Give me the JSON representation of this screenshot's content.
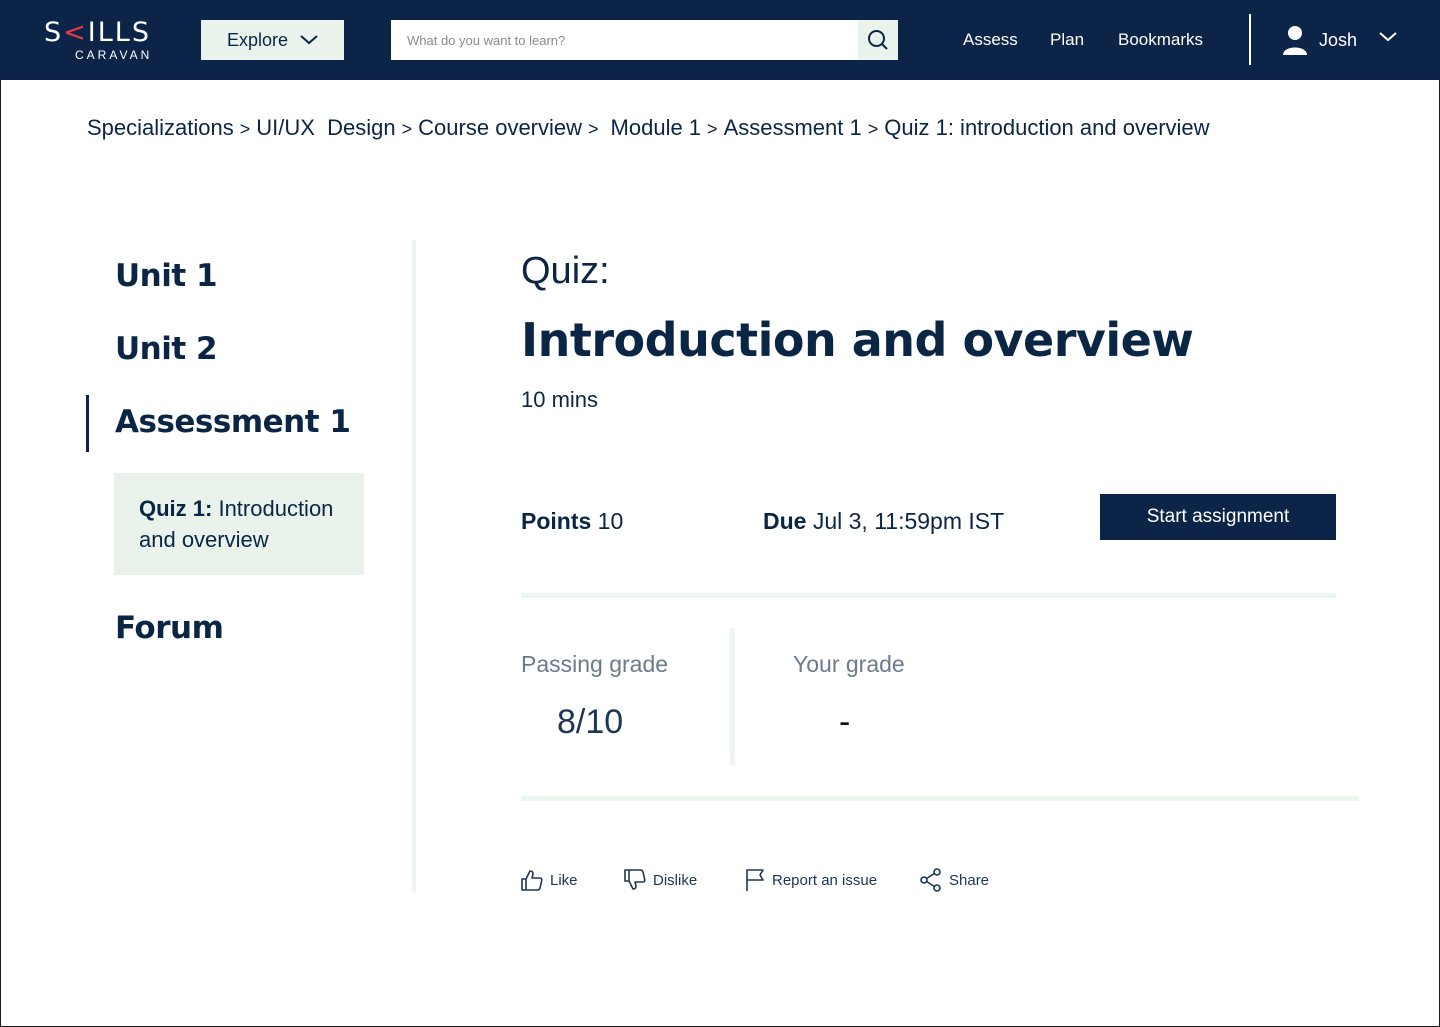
{
  "navbar": {
    "logo_main_pre": "S",
    "logo_main_k": "<",
    "logo_main_post": "ILLS",
    "logo_sub": "CARAVAN",
    "explore_label": "Explore",
    "search_placeholder": "What do you want to learn?",
    "links": [
      "Assess",
      "Plan",
      "Bookmarks"
    ],
    "user_name": "Josh"
  },
  "breadcrumb": [
    "Specializations",
    "UI/UX  Design",
    "Course overview",
    "Module 1",
    "Assessment 1",
    "Quiz 1: introduction and overview"
  ],
  "breadcrumb_separator": ">",
  "sidebar": {
    "unit1": "Unit 1",
    "unit2": "Unit 2",
    "assessment": "Assessment 1",
    "quiz_bold": "Quiz 1:",
    "quiz_rest": " Introduction and overview",
    "forum": "Forum"
  },
  "main": {
    "quiz_label": "Quiz:",
    "title": "Introduction and overview",
    "duration": "10 mins",
    "points_label": "Points",
    "points_value": "10",
    "due_label": "Due",
    "due_value": "Jul 3, 11:59pm IST",
    "start_button": "Start assignment",
    "passing_grade_label": "Passing grade",
    "passing_grade_value": "8/10",
    "your_grade_label": "Your grade",
    "your_grade_value": "-"
  },
  "actions": {
    "like": "Like",
    "dislike": "Dislike",
    "report": "Report an issue",
    "share": "Share"
  },
  "colors": {
    "navy": "#0b2448",
    "mint": "#e9f3ec",
    "logo_accent": "#e63946"
  }
}
